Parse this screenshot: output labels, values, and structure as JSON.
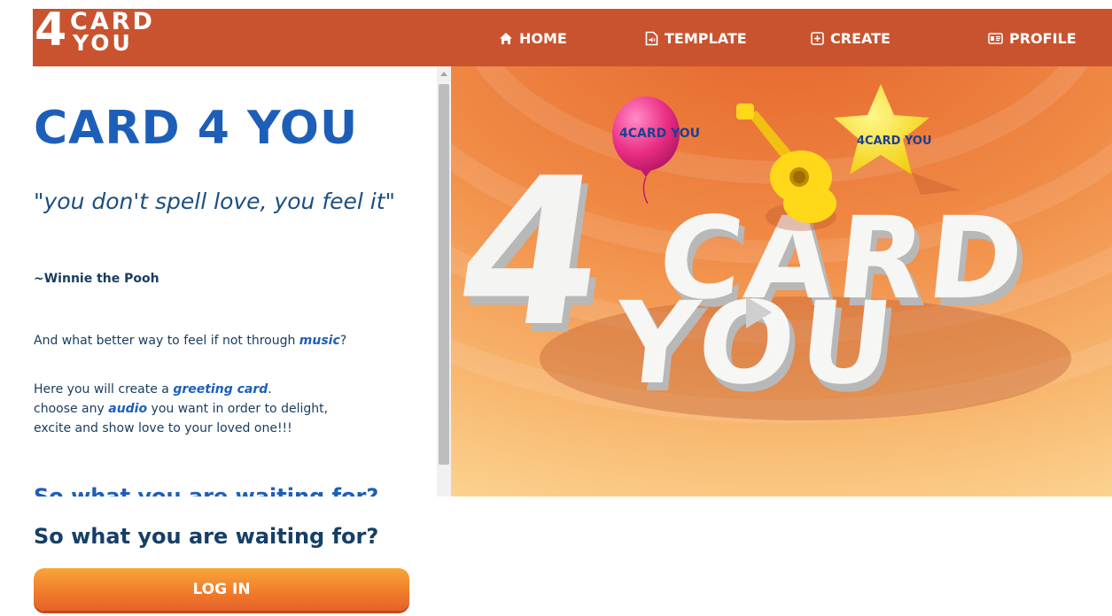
{
  "logo": {
    "four": "4",
    "card": "CARD",
    "you": "YOU"
  },
  "nav": {
    "home": "HOME",
    "template": "TEMPLATE",
    "create": "CREATE",
    "profile": "PROFILE"
  },
  "content": {
    "title": "CARD 4 YOU",
    "quote": "\"you don't spell love, you feel it\"",
    "quote_author": "~Winnie the Pooh",
    "intro_prefix": "And what better way to feel if not through ",
    "intro_em": "music",
    "intro_suffix": "?",
    "line1_prefix": "Here you will create a ",
    "line1_em": "greeting card",
    "line1_suffix": ".",
    "line2_prefix": "choose any ",
    "line2_em": "audio",
    "line2_suffix": " you want in order to delight,",
    "line3": "excite and show love to your loved one!!!",
    "peek_heading": "So what you are waiting for?"
  },
  "hero": {
    "big_four": "4",
    "word_card": "CARD",
    "word_you": "YOU",
    "balloon_text": "4CARD YOU",
    "star_text": "4CARD YOU"
  },
  "cta": {
    "heading": "So what you are waiting for?",
    "login_label": "LOG IN"
  },
  "colors": {
    "nav_bg": "#c9532f",
    "title_blue": "#1d5fb8",
    "text_dark": "#1a3d60",
    "button_orange": "#f07a2a"
  },
  "icons": {
    "home": "home-icon",
    "template": "music-file-icon",
    "create": "plus-square-icon",
    "profile": "id-card-icon"
  }
}
